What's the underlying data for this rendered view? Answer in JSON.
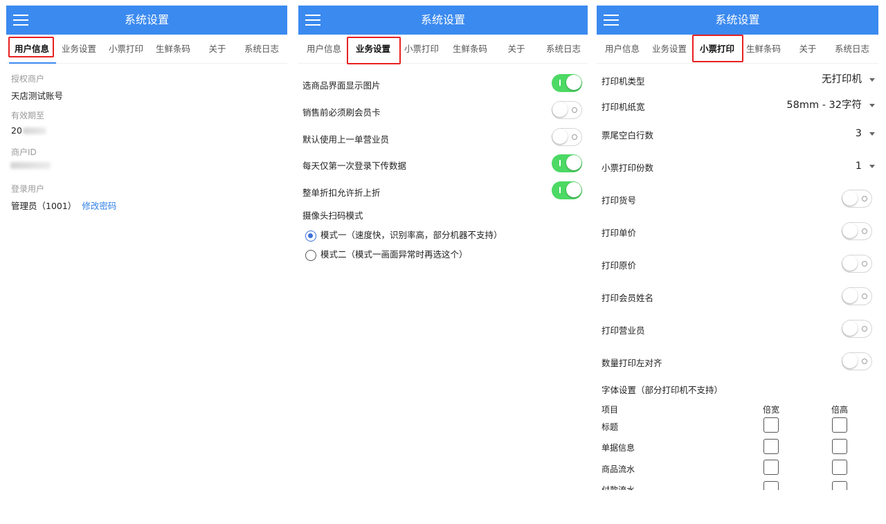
{
  "colors": {
    "header": "#3b8af0",
    "toggle_on": "#4cd964",
    "highlight": "#e82020",
    "link": "#2f80e8"
  },
  "header": {
    "title": "系统设置"
  },
  "tabs": [
    "用户信息",
    "业务设置",
    "小票打印",
    "生鲜条码",
    "关于",
    "系统日志"
  ],
  "user_info": {
    "authorized_merchant_label": "授权商户",
    "authorized_merchant_value": "天店测试账号",
    "valid_until_label": "有效期至",
    "valid_until_value": "20",
    "merchant_id_label": "商户ID",
    "login_user_label": "登录用户",
    "login_user_value": "管理员（1001）",
    "change_password": "修改密码"
  },
  "business": {
    "settings": [
      {
        "label": "选商品界面显示图片",
        "on": true
      },
      {
        "label": "销售前必须刷会员卡",
        "on": false
      },
      {
        "label": "默认使用上一单营业员",
        "on": false
      },
      {
        "label": "每天仅第一次登录下传数据",
        "on": true
      },
      {
        "label": "整单折扣允许折上折",
        "on": true
      }
    ],
    "camera_mode_label": "摄像头扫码模式",
    "modes": [
      {
        "label": "模式一（速度快，识别率高，部分机器不支持）",
        "checked": true
      },
      {
        "label": "模式二（模式一画面异常时再选这个）",
        "checked": false
      }
    ]
  },
  "printing": {
    "dropdowns": [
      {
        "label": "打印机类型",
        "value": "无打印机"
      },
      {
        "label": "打印机纸宽",
        "value": "58mm - 32字符"
      },
      {
        "label": "票尾空白行数",
        "value": "3"
      },
      {
        "label": "小票打印份数",
        "value": "1"
      }
    ],
    "toggles": [
      {
        "label": "打印货号",
        "on": false
      },
      {
        "label": "打印单价",
        "on": false
      },
      {
        "label": "打印原价",
        "on": false
      },
      {
        "label": "打印会员姓名",
        "on": false
      },
      {
        "label": "打印营业员",
        "on": false
      },
      {
        "label": "数量打印左对齐",
        "on": false
      }
    ],
    "font_settings": {
      "title": "字体设置（部分打印机不支持）",
      "headers": [
        "项目",
        "倍宽",
        "倍高"
      ],
      "rows": [
        "标题",
        "单据信息",
        "商品流水",
        "付款流水"
      ]
    }
  }
}
